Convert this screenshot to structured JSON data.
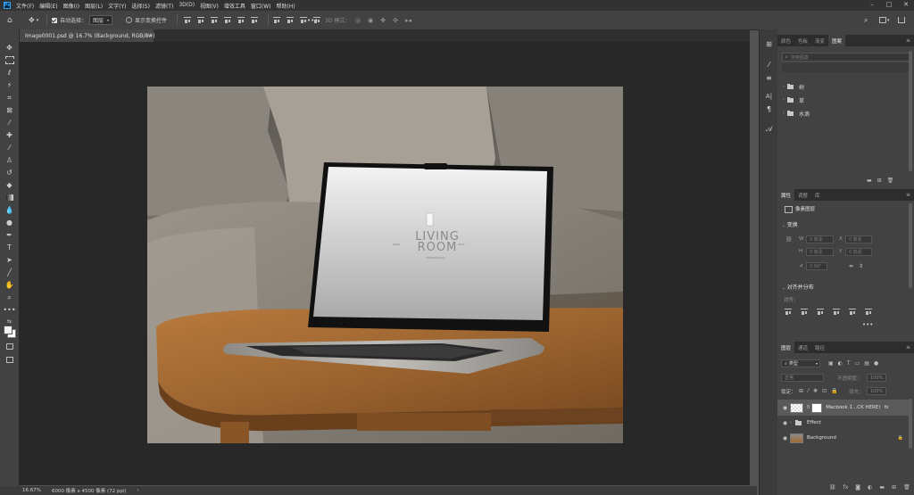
{
  "menu": {
    "logo": "Ps",
    "items": [
      "文件(F)",
      "编辑(E)",
      "图像(I)",
      "图层(L)",
      "文字(Y)",
      "选择(S)",
      "滤镜(T)",
      "3D(D)",
      "视图(V)",
      "增效工具",
      "窗口(W)",
      "帮助(H)"
    ]
  },
  "options": {
    "auto_select_label": "自动选择：",
    "auto_select_value": "图层",
    "show_transform_label": "显示变换控件",
    "more": "•••",
    "mode_label": "3D 模式："
  },
  "document": {
    "tab_title": "Image0001.psd @ 16.7% (Background, RGB/8#)",
    "close": "×"
  },
  "status": {
    "zoom": "16.67%",
    "size": "6000 像素 x 4500 像素 (72 ppi)",
    "arrow": "›"
  },
  "photo": {
    "line1": "LIVING",
    "line2": "ROOM",
    "left_year": "2024",
    "right_year": "2037",
    "sub": "INTERIOR DESIGN"
  },
  "top_panel": {
    "tabs": [
      "颜色",
      "色板",
      "渐变",
      "图案"
    ],
    "active": 3,
    "search_placeholder": "搜索图案",
    "groups": [
      "树",
      "草",
      "水滴"
    ]
  },
  "props_panel": {
    "tabs": [
      "属性",
      "调整",
      "库"
    ],
    "active": 0,
    "layer_type": "像素图层",
    "transform_title": "变换",
    "w_label": "W",
    "h_label": "H",
    "x_label": "X",
    "y_label": "Y",
    "unit_placeholder": "0 像素",
    "angle_value": "0.00°",
    "align_title": "对齐并分布",
    "align_label": "对齐：",
    "more": "•••"
  },
  "layers_panel": {
    "tabs": [
      "图层",
      "通道",
      "路径"
    ],
    "active": 0,
    "kind_label": "类型",
    "blend_mode": "正常",
    "opacity_label": "不透明度：",
    "opacity_value": "100%",
    "lock_label": "锁定：",
    "fill_label": "填充：",
    "fill_value": "100%",
    "layers": [
      {
        "name": "Macbook 1...CK HERE)",
        "type": "smart",
        "fx": "fx"
      },
      {
        "name": "Effect",
        "type": "group"
      },
      {
        "name": "Background",
        "type": "pixel"
      }
    ],
    "footer_icons": [
      "link-icon",
      "fx-icon",
      "mask-icon",
      "adjustment-icon",
      "folder-icon",
      "new-layer-icon",
      "trash-icon"
    ]
  },
  "colors": {
    "chrome_dark": "#323232",
    "panel": "#424242",
    "canvas_bg": "#282828",
    "accent": "#31a8ff"
  }
}
